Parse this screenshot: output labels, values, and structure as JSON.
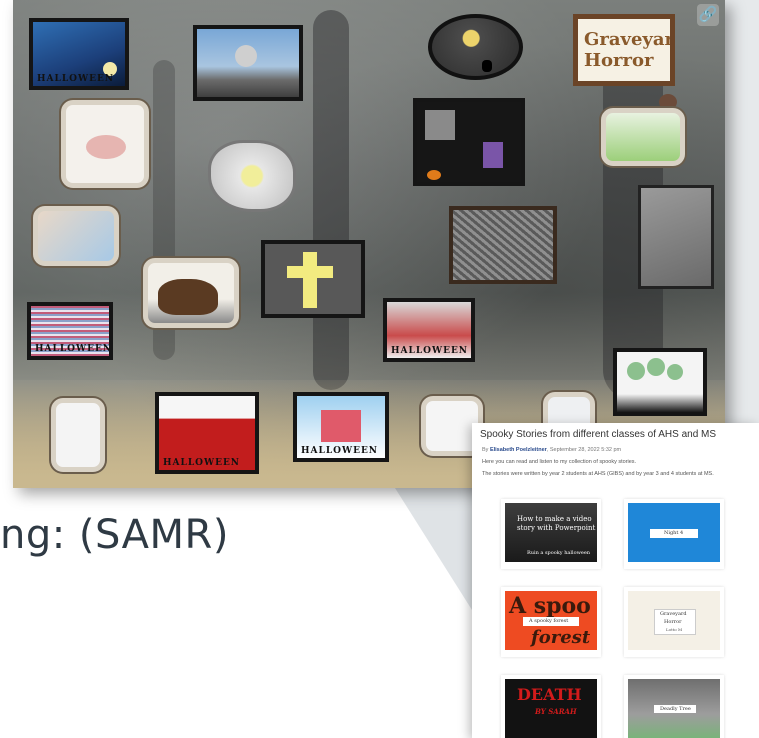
{
  "slide": {
    "heading_fragment": "ng: (SAMR)"
  },
  "board": {
    "tiles": [
      {
        "name": "halloween-night-sky",
        "caption": "HALLOWEEN"
      },
      {
        "name": "graveyard-moon"
      },
      {
        "name": "moon-cat-oval"
      },
      {
        "name": "graveyard-horror-title",
        "caption": "Graveyard Horror"
      },
      {
        "name": "angels-drawing"
      },
      {
        "name": "haunted-castle-witch"
      },
      {
        "name": "spider-skull"
      },
      {
        "name": "ghost-cloud"
      },
      {
        "name": "landscape-drawing"
      },
      {
        "name": "gray-stone"
      },
      {
        "name": "two-figures"
      },
      {
        "name": "sketch-window"
      },
      {
        "name": "brown-cat"
      },
      {
        "name": "yellow-cross",
        "caption": "HALLOWEEN"
      },
      {
        "name": "pattern-halloween",
        "caption": "HALLOWEEN"
      },
      {
        "name": "house-halloween",
        "caption": "HALLOWEEN"
      },
      {
        "name": "trees-night"
      },
      {
        "name": "ghost-white"
      },
      {
        "name": "red-fire",
        "caption": "HALLOWEEN"
      },
      {
        "name": "red-house-snow",
        "caption": "HALLOWEEN"
      },
      {
        "name": "cloudy-tree"
      },
      {
        "name": "blade"
      }
    ]
  },
  "panel": {
    "title": "Spooky Stories from different classes of AHS and MS",
    "by_prefix": "By",
    "author": "Elisabeth Poelzleitner",
    "date": ", September 28, 2022 5:32 pm",
    "intro": "Here you can read and listen to my collection of spooky stories.",
    "description": "The stories were written by year 2 students at AHS (GIBS) and by year 3 and 4 students at MS.",
    "cards": [
      {
        "name": "video-card",
        "line1": "How to make a video",
        "line2": "story with Powerpoint",
        "line3": "Ruin a spooky halloween"
      },
      {
        "name": "blue-card",
        "line1": "Night 4"
      },
      {
        "name": "spooky-forest-card",
        "big": "A spoo",
        "line1": "A spooky forest",
        "big2": "forest"
      },
      {
        "name": "graveyard-card",
        "line1": "Graveyard",
        "line2": "Horror",
        "line3": "Lotto M"
      },
      {
        "name": "death-card",
        "big": "DEATH",
        "line1": "BY SARAH"
      },
      {
        "name": "deadly-tree-card",
        "line1": "Deadly Tree"
      }
    ]
  },
  "colors": {
    "heading": "#2f3a44",
    "author_link": "#2a4b8d",
    "callout": "#d6dade"
  },
  "icons": {
    "link": "link-icon"
  }
}
